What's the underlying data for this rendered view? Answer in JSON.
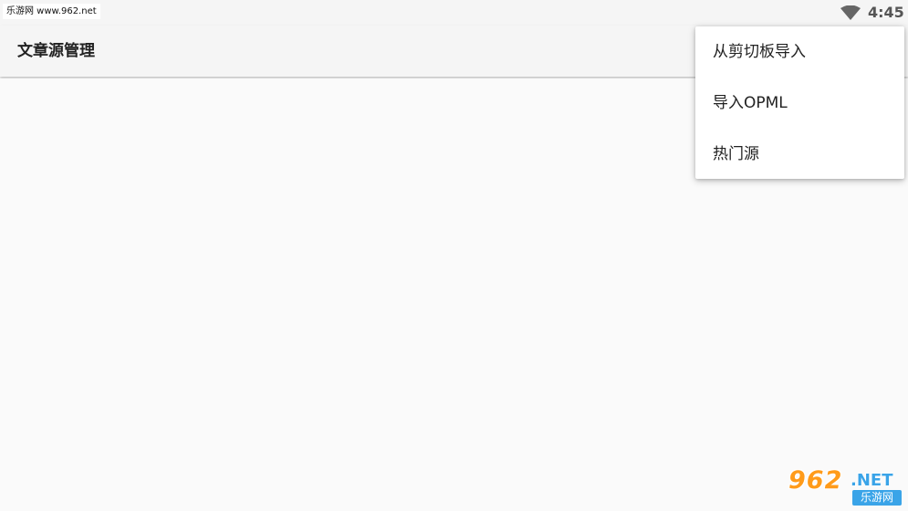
{
  "status_bar": {
    "watermark": "乐游网 www.962.net",
    "time": "4:45",
    "wifi_icon": "wifi-icon"
  },
  "app_bar": {
    "title": "文章源管理"
  },
  "overflow_menu": {
    "items": [
      {
        "label": "从剪切板导入"
      },
      {
        "label": "导入OPML"
      },
      {
        "label": "热门源"
      }
    ]
  },
  "logo": {
    "main": "962",
    "suffix": ".NET",
    "sub": "乐游网"
  },
  "colors": {
    "background": "#fafafa",
    "app_bar": "#f5f5f5",
    "menu": "#ffffff",
    "logo_orange": "#ff9b1a",
    "logo_blue": "#3aa4e8"
  }
}
